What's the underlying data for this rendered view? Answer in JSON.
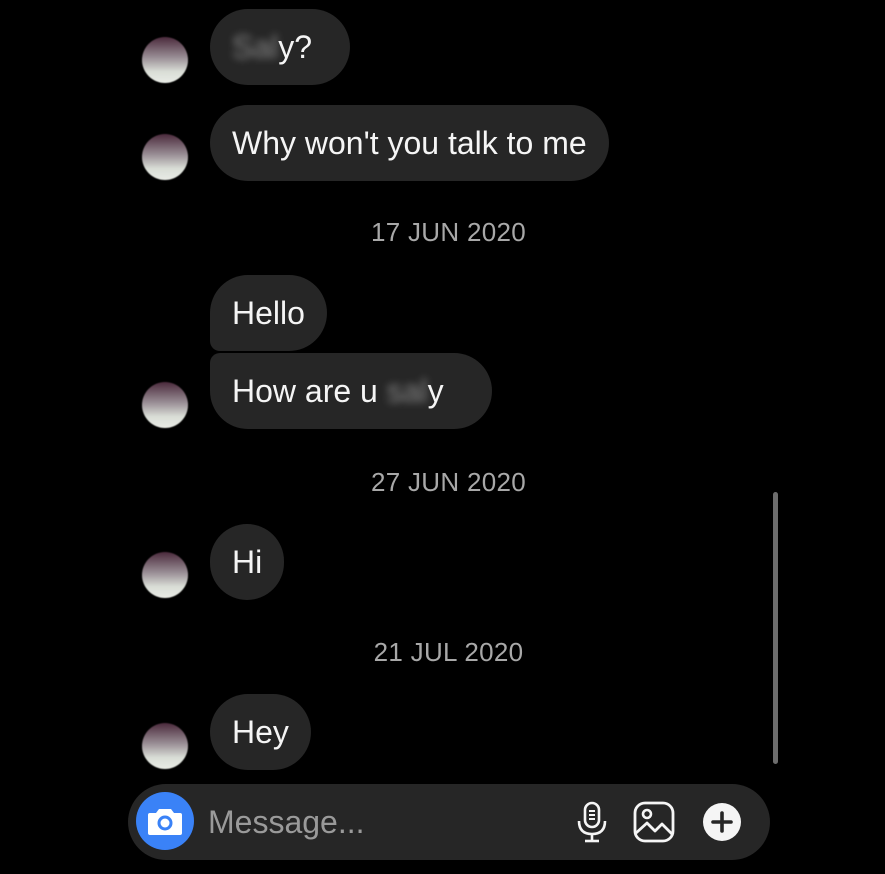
{
  "conversation": {
    "messages": [
      {
        "text": "y?"
      },
      {
        "text": "Why won't you talk to me"
      },
      {
        "text": "Hello"
      },
      {
        "prefix": "How are u",
        "suffix": "y"
      },
      {
        "text": "Hi"
      },
      {
        "text": "Hey"
      }
    ],
    "dates": [
      "17 JUN 2020",
      "27 JUN 2020",
      "21 JUL 2020"
    ]
  },
  "composer": {
    "placeholder": "Message...",
    "camera_icon": "camera-icon",
    "mic_icon": "microphone-icon",
    "gallery_icon": "image-icon",
    "plus_icon": "plus-icon"
  },
  "colors": {
    "background": "#000000",
    "bubble": "#262626",
    "accent": "#3a82f7",
    "date_text": "#a8a8a8"
  }
}
